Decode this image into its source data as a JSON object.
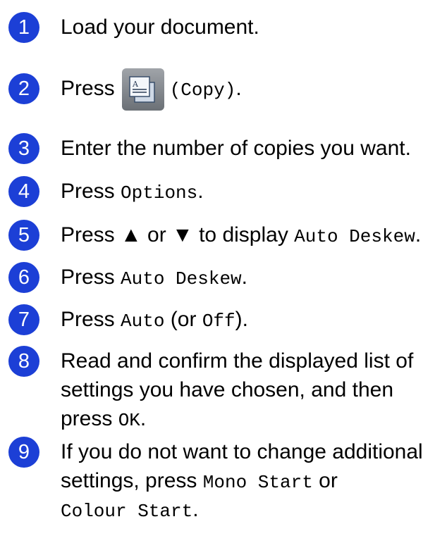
{
  "steps": [
    {
      "number": "1",
      "text": "Load your document."
    },
    {
      "number": "2",
      "pre": "Press",
      "icon": "copy-icon",
      "code": "(Copy)",
      "post": "."
    },
    {
      "number": "3",
      "text": "Enter the number of copies you want."
    },
    {
      "number": "4",
      "pre": "Press",
      "code": "Options",
      "post": "."
    },
    {
      "number": "5",
      "pre": "Press ▲ or ▼ to display",
      "code": "Auto Deskew",
      "post": "."
    },
    {
      "number": "6",
      "pre": "Press",
      "code": "Auto Deskew",
      "post": "."
    },
    {
      "number": "7",
      "pre": "Press",
      "code": "Auto",
      "mid": "(or",
      "code2": "Off",
      "post": ")."
    },
    {
      "number": "8",
      "line1": "Read and confirm the displayed list of",
      "line2": "settings you have chosen, and then",
      "line3_pre": "press",
      "line3_code": "OK",
      "line3_post": "."
    },
    {
      "number": "9",
      "line1": "If you do not want to change additional",
      "line2_pre": "settings, press",
      "line2_code": "Mono Start",
      "line2_post": "or",
      "line3_code": "Colour Start",
      "line3_post": "."
    }
  ],
  "colors": {
    "bullet": "#1c3fd6",
    "text": "#000000"
  }
}
